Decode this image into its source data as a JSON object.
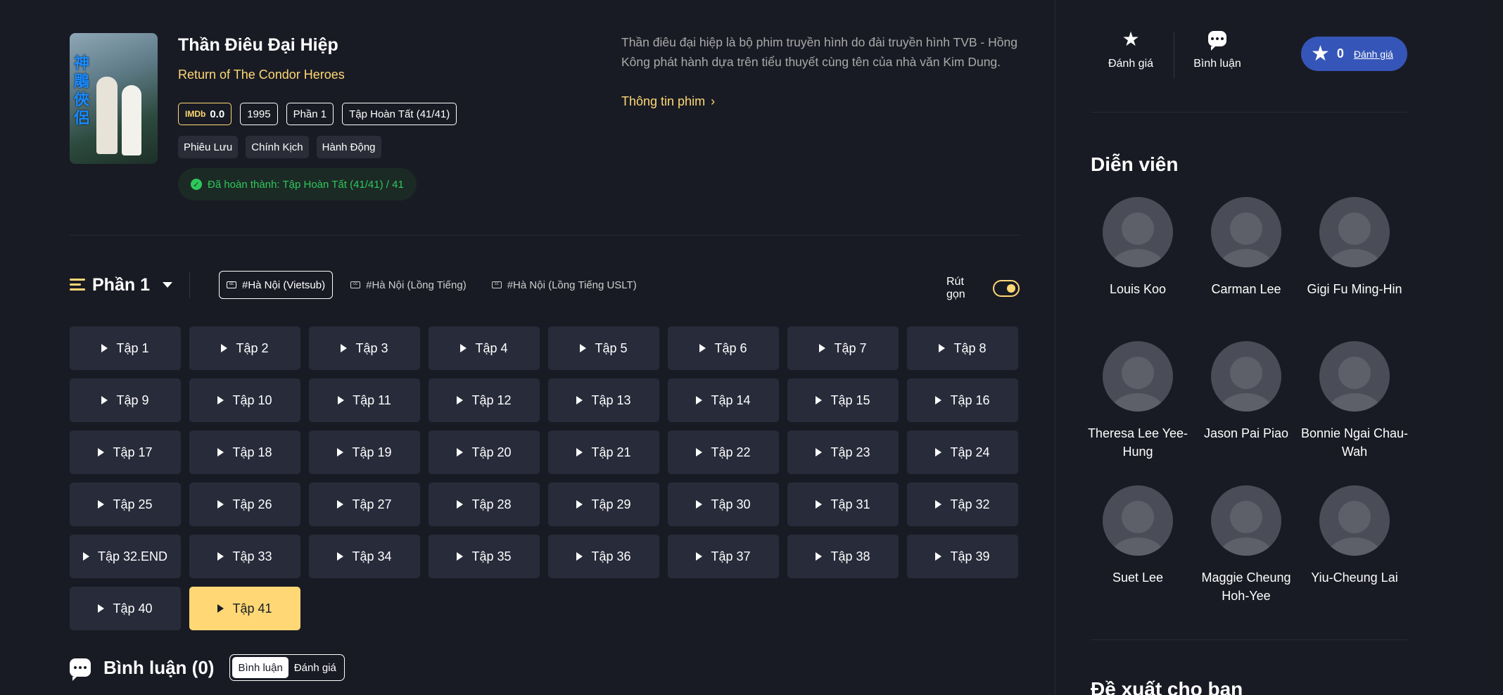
{
  "movie": {
    "title": "Thần Điêu Đại Hiệp",
    "subtitle": "Return of The Condor Heroes",
    "poster_glyphs": "神鵰俠侶",
    "imdb_label": "IMDb",
    "imdb_score": "0.0",
    "year": "1995",
    "season_tag": "Phần 1",
    "episodes_tag": "Tập Hoàn Tất (41/41)",
    "genres": [
      "Phiêu Lưu",
      "Chính Kịch",
      "Hành Động"
    ],
    "status": "Đã hoàn thành: Tập Hoàn Tất (41/41) / 41",
    "description": "Thần điêu đại hiệp là bộ phim truyền hình do đài truyền hình TVB - Hồng Kông phát hành dựa trên tiểu thuyết cùng tên của nhà văn Kim Dung.",
    "more_info": "Thông tin phim"
  },
  "season_bar": {
    "season_label": "Phần 1",
    "servers": [
      "#Hà Nội (Vietsub)",
      "#Hà Nội (Lồng Tiếng)",
      "#Hà Nội (Lồng Tiếng USLT)"
    ],
    "active_server": 0,
    "compact_label": "Rút gọn",
    "compact_on": true
  },
  "episodes": [
    "Tập 1",
    "Tập 2",
    "Tập 3",
    "Tập 4",
    "Tập 5",
    "Tập 6",
    "Tập 7",
    "Tập 8",
    "Tập 9",
    "Tập 10",
    "Tập 11",
    "Tập 12",
    "Tập 13",
    "Tập 14",
    "Tập 15",
    "Tập 16",
    "Tập 17",
    "Tập 18",
    "Tập 19",
    "Tập 20",
    "Tập 21",
    "Tập 22",
    "Tập 23",
    "Tập 24",
    "Tập 25",
    "Tập 26",
    "Tập 27",
    "Tập 28",
    "Tập 29",
    "Tập 30",
    "Tập 31",
    "Tập 32",
    "Tập 32.END",
    "Tập 33",
    "Tập 34",
    "Tập 35",
    "Tập 36",
    "Tập 37",
    "Tập 38",
    "Tập 39",
    "Tập 40",
    "Tập 41"
  ],
  "active_episode": "Tập 41",
  "comments": {
    "title": "Bình luận (0)",
    "tabs": [
      "Bình luận",
      "Đánh giá"
    ],
    "active_tab": 0
  },
  "sidebar": {
    "rate_label": "Đánh giá",
    "comment_label": "Bình luận",
    "rating_value": "0",
    "rating_link": "Đánh giá",
    "cast_title": "Diễn viên",
    "cast": [
      "Louis Koo",
      "Carman Lee",
      "Gigi Fu Ming-Hin",
      "Theresa Lee Yee-Hung",
      "Jason Pai Piao",
      "Bonnie Ngai Chau-Wah",
      "Suet Lee",
      "Maggie Cheung Hoh-Yee",
      "Yiu-Cheung Lai"
    ],
    "suggest_title": "Đề xuất cho bạn"
  },
  "icons": {
    "rate": "star-icon",
    "comment": "chat-bubble-icon",
    "season": "menu-icon",
    "server": "subtitle-icon",
    "status": "check-circle-icon",
    "episode": "play-icon"
  },
  "colors": {
    "background": "#191b24",
    "accent": "#ffd875",
    "episode_bg": "#282b3a",
    "success": "#2ec85a",
    "rating_pill": "#3556b8"
  }
}
